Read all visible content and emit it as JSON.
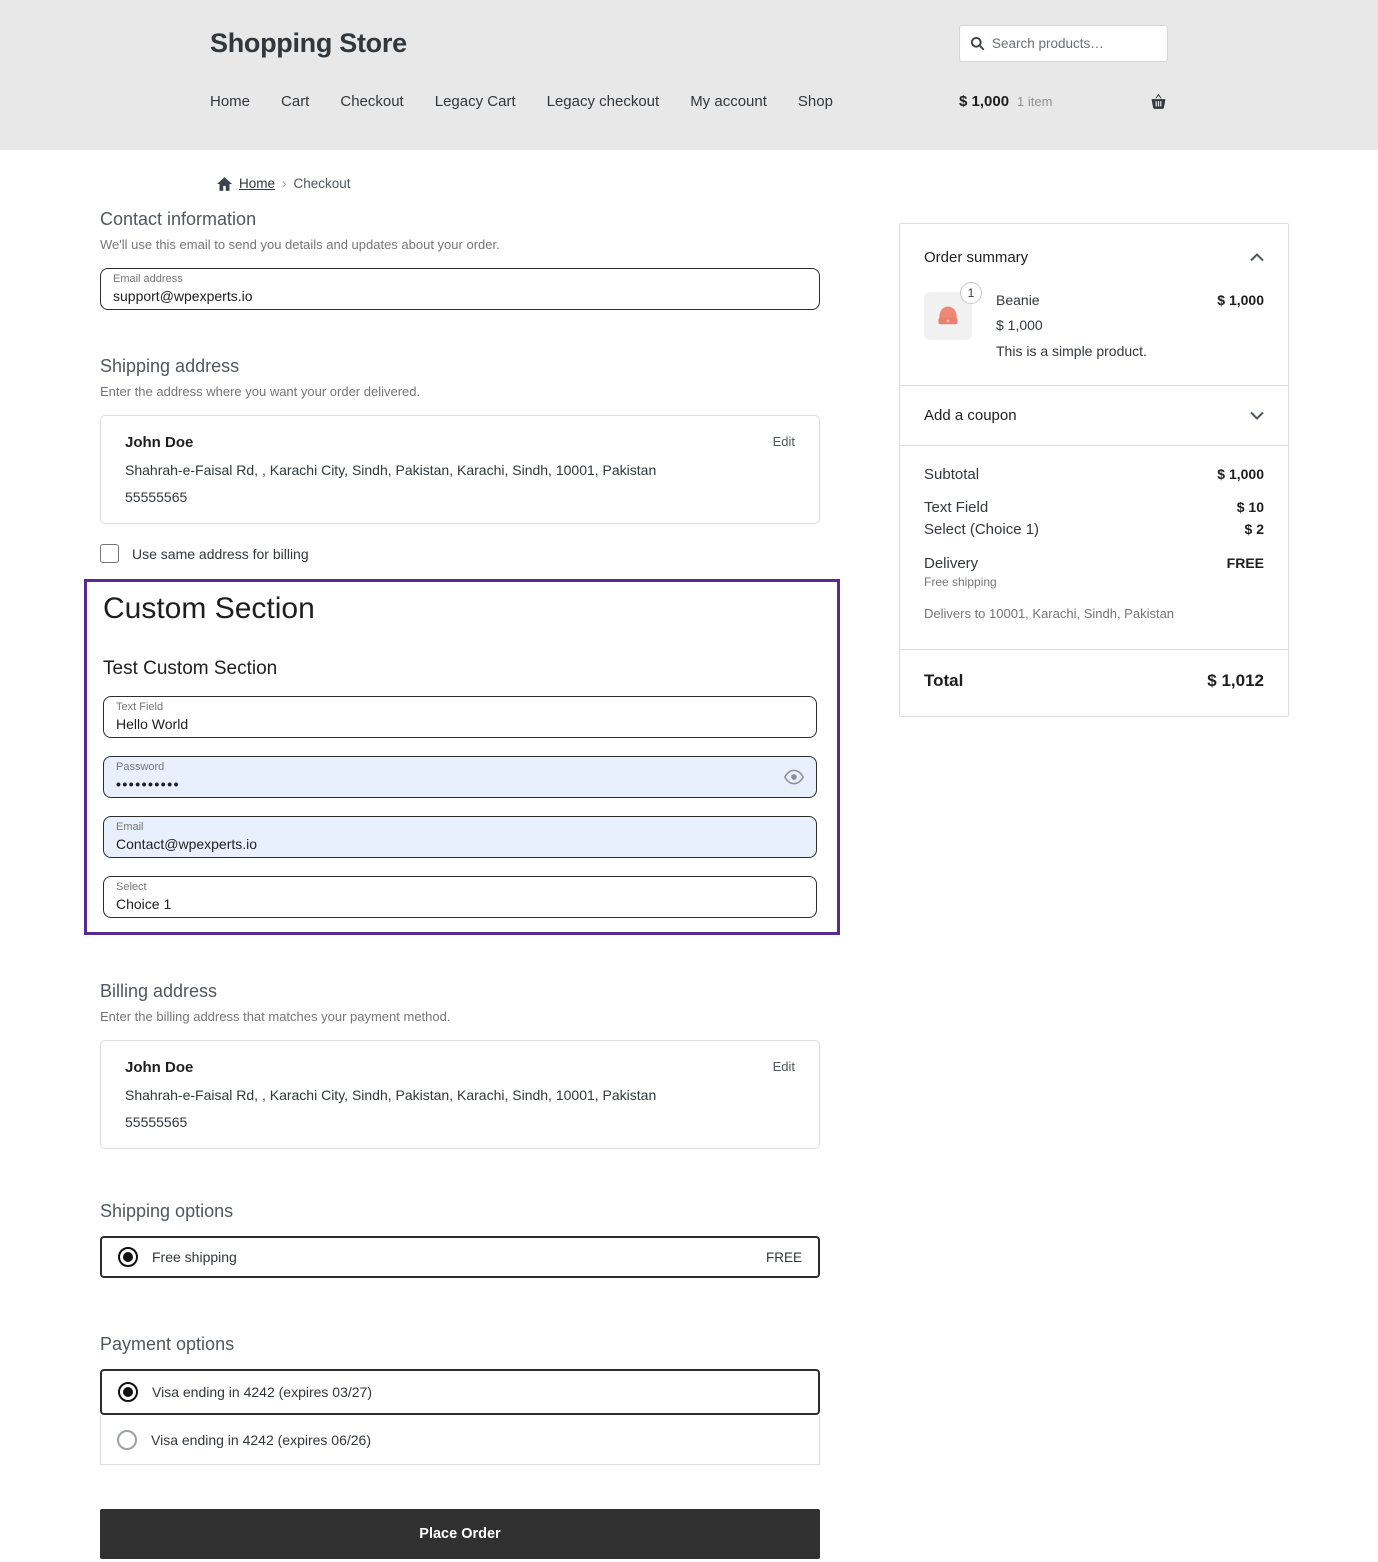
{
  "colors": {
    "accent_purple": "#5b2a8e",
    "autofill_blue": "#e8f0fe",
    "button_dark": "#303030",
    "product_coral": "#ef8777",
    "header_bg": "#e8e8e8"
  },
  "header": {
    "store_title": "Shopping Store",
    "search_placeholder": "Search products…",
    "nav": [
      "Home",
      "Cart",
      "Checkout",
      "Legacy Cart",
      "Legacy checkout",
      "My account",
      "Shop"
    ],
    "cart_total": "$ 1,000",
    "cart_items": "1 item"
  },
  "breadcrumb": {
    "home": "Home",
    "separator": "›",
    "current": "Checkout"
  },
  "contact": {
    "heading": "Contact information",
    "description": "We'll use this email to send you details and updates about your order.",
    "email_label": "Email address",
    "email_value": "support@wpexperts.io"
  },
  "shipping_address": {
    "heading": "Shipping address",
    "description": "Enter the address where you want your order delivered.",
    "name": "John Doe",
    "address": "Shahrah-e-Faisal Rd, , Karachi City, Sindh, Pakistan, Karachi, Sindh, 10001, Pakistan",
    "phone": "55555565",
    "edit_label": "Edit"
  },
  "billing_checkbox_label": "Use same address for billing",
  "custom_section": {
    "title": "Custom Section",
    "subtitle": "Test Custom Section",
    "text_field": {
      "label": "Text Field",
      "value": "Hello World"
    },
    "password_field": {
      "label": "Password",
      "value": "••••••••••"
    },
    "email_field": {
      "label": "Email",
      "value": "Contact@wpexperts.io"
    },
    "select_field": {
      "label": "Select",
      "value": "Choice 1"
    }
  },
  "billing_address": {
    "heading": "Billing address",
    "description": "Enter the billing address that matches your payment method.",
    "name": "John Doe",
    "address": "Shahrah-e-Faisal Rd, , Karachi City, Sindh, Pakistan, Karachi, Sindh, 10001, Pakistan",
    "phone": "55555565",
    "edit_label": "Edit"
  },
  "shipping_options": {
    "heading": "Shipping options",
    "option_label": "Free shipping",
    "option_price": "FREE"
  },
  "payment_options": {
    "heading": "Payment options",
    "options": [
      {
        "label": "Visa ending in 4242 (expires 03/27)",
        "selected": true
      },
      {
        "label": "Visa ending in 4242 (expires 06/26)",
        "selected": false
      }
    ]
  },
  "place_order_label": "Place Order",
  "order_summary": {
    "heading": "Order summary",
    "product": {
      "quantity": "1",
      "name": "Beanie",
      "price": "$ 1,000",
      "unit_price": "$ 1,000",
      "description": "This is a simple product."
    },
    "coupon_label": "Add a coupon",
    "subtotal_label": "Subtotal",
    "subtotal_value": "$ 1,000",
    "fee_rows": [
      {
        "label": "Text Field",
        "value": "$ 10"
      },
      {
        "label": "Select (Choice 1)",
        "value": "$ 2"
      }
    ],
    "delivery_label": "Delivery",
    "delivery_value": "FREE",
    "delivery_method": "Free shipping",
    "delivers_to": "Delivers to 10001, Karachi, Sindh, Pakistan",
    "total_label": "Total",
    "total_value": "$ 1,012"
  }
}
